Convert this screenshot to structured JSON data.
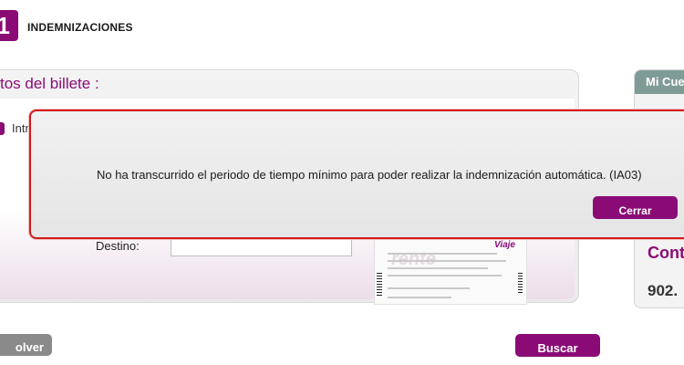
{
  "header": {
    "step_number": "1",
    "title": "INDEMNIZACIONES"
  },
  "panel": {
    "title": "tos del billete :",
    "radio_label": "Intr",
    "destino_label": "Destino:",
    "destino_value": ""
  },
  "ticket": {
    "brand": "Viaje"
  },
  "sidebar": {
    "header": "Mi Cue",
    "contact_label": "Cont",
    "phone": "902."
  },
  "buttons": {
    "volver": "olver",
    "buscar": "Buscar"
  },
  "modal": {
    "message": "No ha transcurrido el periodo de tiempo mínimo para poder realizar la indemnización automática. (IA03)",
    "close_label": "Cerrar"
  },
  "colors": {
    "brand_purple": "#8b0b76",
    "alert_border": "#d11a1a",
    "sidebar_header": "#7f9b96",
    "secondary_button": "#8a8a8a"
  }
}
